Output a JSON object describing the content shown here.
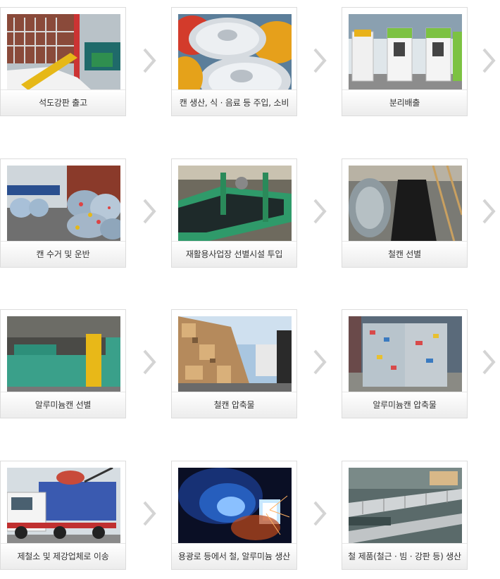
{
  "steps": [
    {
      "label": "석도강판 출고"
    },
    {
      "label": "캔 생산, 식 · 음료 등 주입, 소비"
    },
    {
      "label": "분리배출"
    },
    {
      "label": "캔 수거 및 운반"
    },
    {
      "label": "재활용사업장 선별시설 투입"
    },
    {
      "label": "철캔 선별"
    },
    {
      "label": "알루미늄캔 선별"
    },
    {
      "label": "철캔 압축물"
    },
    {
      "label": "알루미늄캔 압축물"
    },
    {
      "label": "제철소 및 제강업체로 이송"
    },
    {
      "label": "용광로 등에서 철, 알루미늄 생산"
    },
    {
      "label": "철 제품(철근 · 빔 · 강판 등) 생산"
    }
  ],
  "arrow_icon": "chevron-right-icon"
}
